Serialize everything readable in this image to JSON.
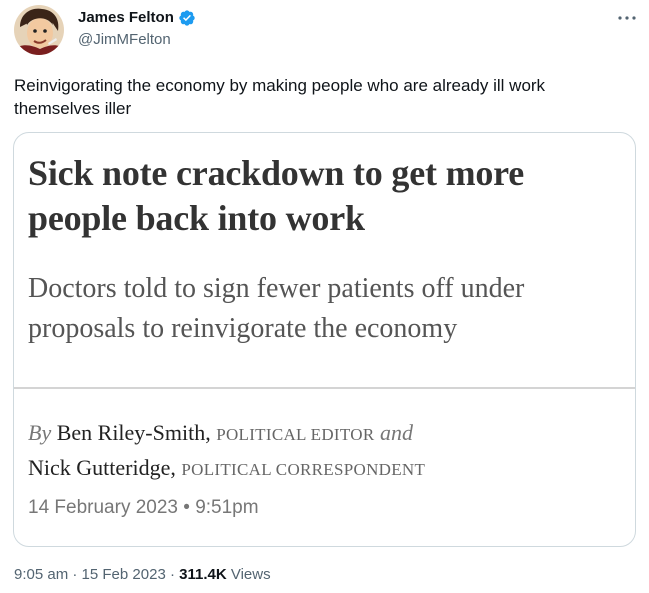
{
  "author": {
    "display_name": "James Felton",
    "handle": "@JimMFelton",
    "verified": true,
    "avatar_icon": "avatar-illustration-icon"
  },
  "tweet": {
    "text": "Reinvigorating the economy by making people who are already ill work themselves iller"
  },
  "card": {
    "headline": "Sick note crackdown to get more people back into work",
    "standfirst": "Doctors told to sign fewer patients off under proposals to reinvigorate the economy",
    "byline": {
      "by": "By",
      "author1_name": "Ben Riley-Smith,",
      "author1_role": "POLITICAL EDITOR",
      "conjunction": "and",
      "author2_name": "Nick Gutteridge,",
      "author2_role": "POLITICAL CORRESPONDENT"
    },
    "date": "14 February 2023 • 9:51pm"
  },
  "meta": {
    "time": "9:05 am",
    "separator": "·",
    "date": "15 Feb 2023",
    "views_count": "311.4K",
    "views_label": "Views"
  },
  "colors": {
    "verified": "#1d9bf0",
    "text": "#0f1419",
    "secondary": "#536471",
    "border": "#cfd9de"
  }
}
